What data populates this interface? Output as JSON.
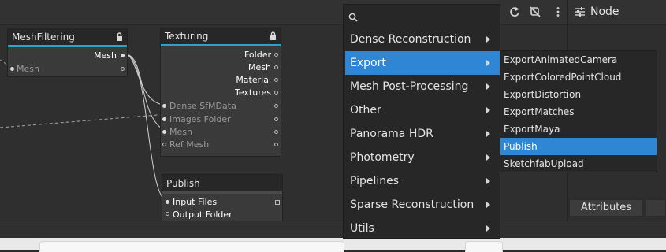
{
  "graph": {
    "nodes": {
      "meshfiltering": {
        "title": "MeshFiltering",
        "output": "Mesh",
        "input": "Mesh"
      },
      "texturing": {
        "title": "Texturing",
        "outputs": [
          "Folder",
          "Mesh",
          "Material",
          "Textures"
        ],
        "inputs": [
          "Dense SfMData",
          "Images Folder",
          "Mesh",
          "Ref Mesh"
        ]
      },
      "publish": {
        "title": "Publish",
        "inputs": [
          "Input Files",
          "Output Folder"
        ]
      }
    }
  },
  "toolbar": {
    "icons": [
      "refresh-icon",
      "disconnect-icon",
      "more-vert-icon",
      "tune-icon"
    ],
    "node_label": "Node"
  },
  "attributes_tab": {
    "label": "Attributes"
  },
  "menu": {
    "search_icon": "search-icon",
    "items": [
      {
        "label": "Dense Reconstruction",
        "active": false
      },
      {
        "label": "Export",
        "active": true
      },
      {
        "label": "Mesh Post-Processing",
        "active": false
      },
      {
        "label": "Other",
        "active": false
      },
      {
        "label": "Panorama HDR",
        "active": false
      },
      {
        "label": "Photometry",
        "active": false
      },
      {
        "label": "Pipelines",
        "active": false
      },
      {
        "label": "Sparse Reconstruction",
        "active": false
      },
      {
        "label": "Utils",
        "active": false
      }
    ]
  },
  "submenu": {
    "items": [
      {
        "label": "ExportAnimatedCamera",
        "active": false
      },
      {
        "label": "ExportColoredPointCloud",
        "active": false
      },
      {
        "label": "ExportDistortion",
        "active": false
      },
      {
        "label": "ExportMatches",
        "active": false
      },
      {
        "label": "ExportMaya",
        "active": false
      },
      {
        "label": "Publish",
        "active": true
      },
      {
        "label": "SketchfabUpload",
        "active": false
      }
    ]
  },
  "colors": {
    "accent": "#2f86d4",
    "node_header_bar": "#2aa3c8",
    "background": "#2f2f2f"
  }
}
